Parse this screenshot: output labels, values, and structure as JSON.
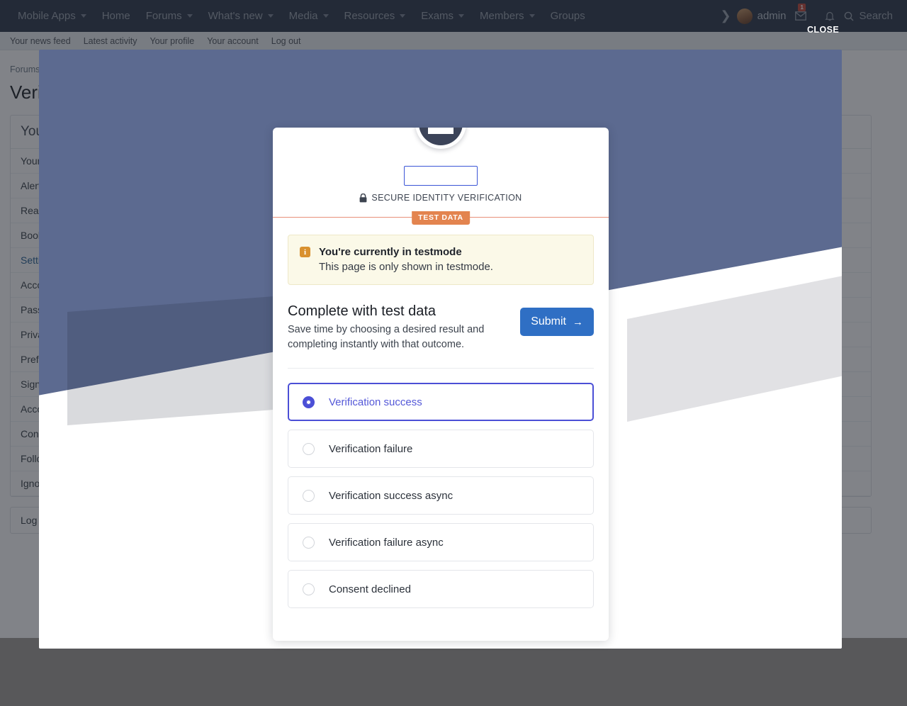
{
  "forum": {
    "nav": [
      {
        "label": "Mobile Apps",
        "has_caret": true
      },
      {
        "label": "Home",
        "has_caret": false
      },
      {
        "label": "Forums",
        "has_caret": true
      },
      {
        "label": "What's new",
        "has_caret": true
      },
      {
        "label": "Media",
        "has_caret": true
      },
      {
        "label": "Resources",
        "has_caret": true
      },
      {
        "label": "Exams",
        "has_caret": true
      },
      {
        "label": "Members",
        "has_caret": true
      },
      {
        "label": "Groups",
        "has_caret": false
      }
    ],
    "user": "admin",
    "inbox_badge": "1",
    "search_label": "Search",
    "subnav": [
      "Your news feed",
      "Latest activity",
      "Your profile",
      "Your account",
      "Log out"
    ],
    "breadcrumb": "Forums",
    "page_title": "Verification",
    "panel_heading": "Your account",
    "panel_rows": [
      "Your news feed",
      "Alerts",
      "Reactions",
      "Bookmarks",
      "Settings",
      "Account details",
      "Password and security",
      "Privacy",
      "Preferences",
      "Signature",
      "Account upgrades",
      "Connected accounts",
      "Following",
      "Ignoring"
    ],
    "logout_label": "Log out"
  },
  "browser": {
    "close_label": "CLOSE"
  },
  "modal": {
    "name_value": "",
    "name_placeholder": "",
    "secure_label": "SECURE IDENTITY VERIFICATION",
    "test_data_tab": "TEST DATA",
    "testmode": {
      "info_glyph": "i",
      "title": "You're currently in testmode",
      "subtitle": "This page is only shown in testmode."
    },
    "complete": {
      "title": "Complete with test data",
      "subtitle": "Save time by choosing a desired result and completing instantly with that outcome.",
      "submit_label": "Submit",
      "submit_arrow": "→"
    },
    "options": [
      {
        "label": "Verification success",
        "selected": true
      },
      {
        "label": "Verification failure",
        "selected": false
      },
      {
        "label": "Verification success async",
        "selected": false
      },
      {
        "label": "Verification failure async",
        "selected": false
      },
      {
        "label": "Consent declined",
        "selected": false
      }
    ]
  },
  "colors": {
    "nav_bg": "#2f3b4c",
    "overlay_bg": "#5c6a90",
    "accent_blue": "#2f6fc4",
    "radio_indigo": "#4b4fd6",
    "test_tab_orange": "#e3844f",
    "note_bg": "#fbf9e8",
    "page_chrome": "#58585a"
  }
}
